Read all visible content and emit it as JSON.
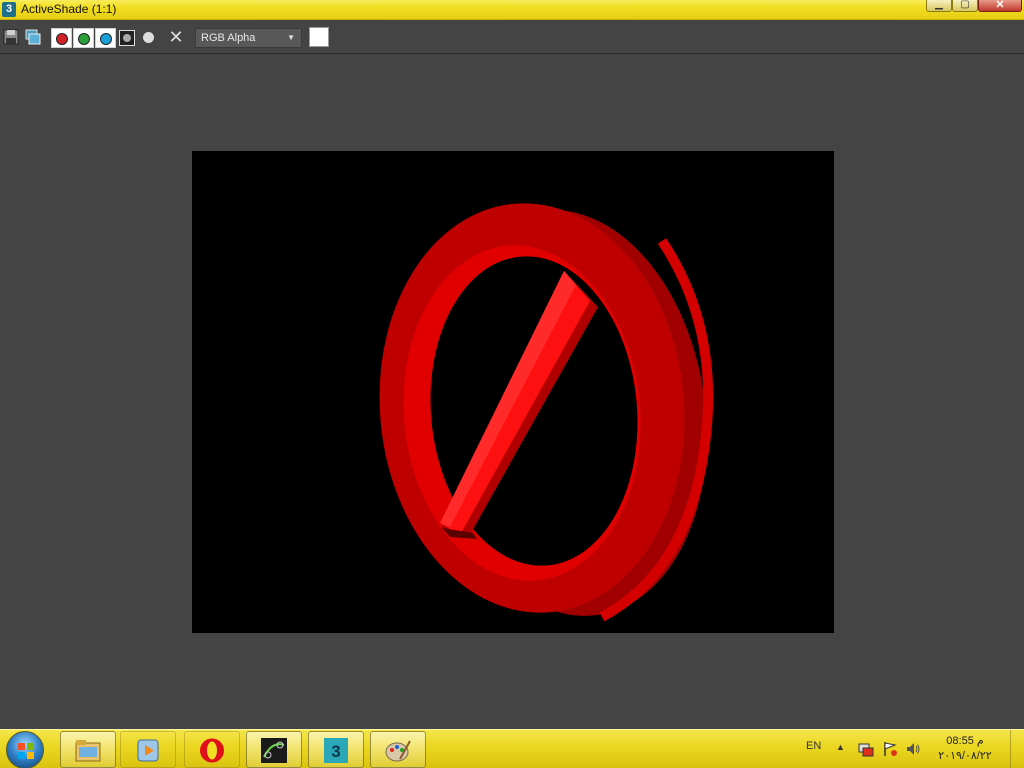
{
  "window": {
    "title": "ActiveShade (1:1)",
    "app_icon_label": "3"
  },
  "toolbar": {
    "display_channel": "RGB Alpha",
    "clear_label": "✕"
  },
  "taskbar": {
    "apps": [
      {
        "name": "file-explorer",
        "active": true
      },
      {
        "name": "media-player",
        "active": false
      },
      {
        "name": "opera",
        "active": false
      },
      {
        "name": "graphics-app",
        "active": true
      },
      {
        "name": "3ds-max",
        "active": true,
        "label": "3"
      },
      {
        "name": "paint",
        "active": true
      }
    ],
    "language": "EN",
    "time": "08:55 م",
    "date": "٢٠١٩/٠٨/٢٢"
  },
  "colors": {
    "accent_yellow": "#f2de20",
    "viewport_bg": "#444444",
    "render_bg": "#000000",
    "sign_red": "#cc0000"
  }
}
